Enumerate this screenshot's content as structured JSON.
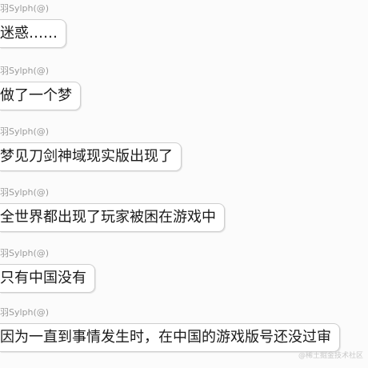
{
  "messages": [
    {
      "sender": "羽Sylph(@)",
      "text": "迷惑……"
    },
    {
      "sender": "羽Sylph(@)",
      "text": "做了一个梦"
    },
    {
      "sender": "羽Sylph(@)",
      "text": "梦见刀剑神域现实版出现了"
    },
    {
      "sender": "羽Sylph(@)",
      "text": "全世界都出现了玩家被困在游戏中"
    },
    {
      "sender": "羽Sylph(@)",
      "text": "只有中国没有"
    },
    {
      "sender": "羽Sylph(@)",
      "text": "因为一直到事情发生时，在中国的游戏版号还没过审"
    }
  ],
  "watermark": "@稀土掘金技术社区"
}
